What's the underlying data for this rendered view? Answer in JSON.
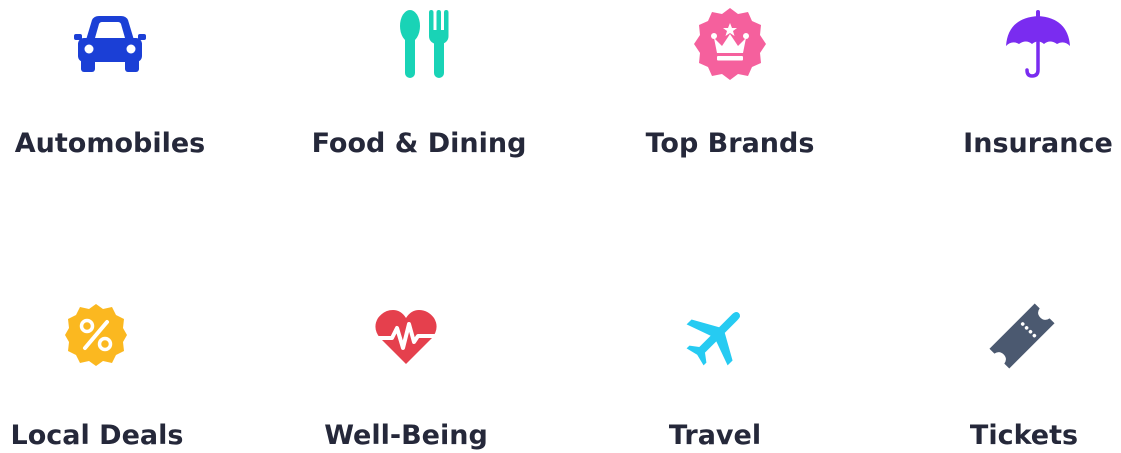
{
  "categories": [
    {
      "label": "Automobiles",
      "icon": "car-icon",
      "color": "#1b3fd6"
    },
    {
      "label": "Food & Dining",
      "icon": "fork-spoon-icon",
      "color": "#19d3b6"
    },
    {
      "label": "Top Brands",
      "icon": "crown-badge-icon",
      "color": "#f5609d"
    },
    {
      "label": "Insurance",
      "icon": "umbrella-icon",
      "color": "#7a2cf0"
    },
    {
      "label": "Local Deals",
      "icon": "percent-badge-icon",
      "color": "#fbb820"
    },
    {
      "label": "Well-Being",
      "icon": "heartbeat-icon",
      "color": "#e5404d"
    },
    {
      "label": "Travel",
      "icon": "airplane-icon",
      "color": "#26cbf2"
    },
    {
      "label": "Tickets",
      "icon": "ticket-icon",
      "color": "#4b5970"
    }
  ],
  "text_color": "#25283a"
}
